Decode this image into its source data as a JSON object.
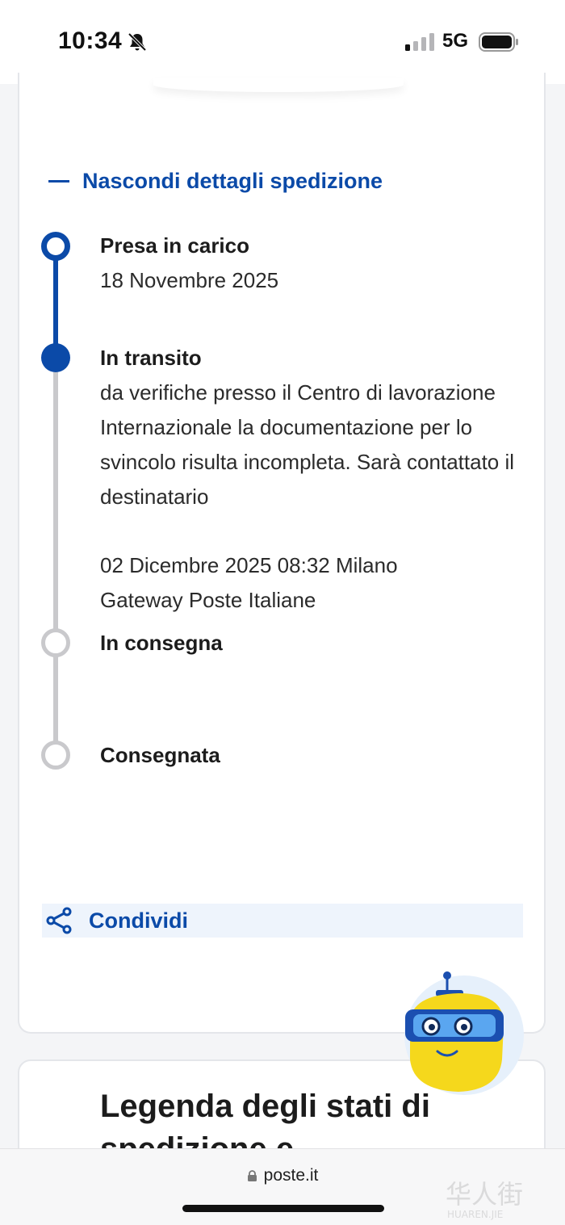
{
  "status_bar": {
    "time": "10:34",
    "network": "5G",
    "icons": [
      "bell-muted-icon",
      "signal-icon",
      "battery-icon"
    ]
  },
  "tracking": {
    "toggle_label": "Nascondi dettagli spedizione",
    "steps": [
      {
        "title": "Presa in carico",
        "detail": "18 Novembre 2025",
        "state": "completed"
      },
      {
        "title": "In transito",
        "detail": "da verifiche presso il Centro di lavorazione Internazionale la documentazione per lo svincolo risulta incompleta. Sarà contattato il destinatario",
        "date": "02 Dicembre 2025 08:32 Milano Gateway Poste Italiane",
        "state": "current"
      },
      {
        "title": "In consegna",
        "detail": "",
        "state": "pending"
      },
      {
        "title": "Consegnata",
        "detail": "",
        "state": "pending"
      }
    ],
    "share_label": "Condividi"
  },
  "legend": {
    "title": "Legenda degli stati di",
    "title_cut": "spedizione e informazioni"
  },
  "browser": {
    "url": "poste.it"
  },
  "watermark": {
    "text": "华人街",
    "subtext": "HUAREN.JIE"
  },
  "colors": {
    "accent": "#0b4aa8",
    "pending": "#c9c9cc",
    "share_bg": "#eef4fc",
    "robot_yellow": "#f5d81c"
  }
}
